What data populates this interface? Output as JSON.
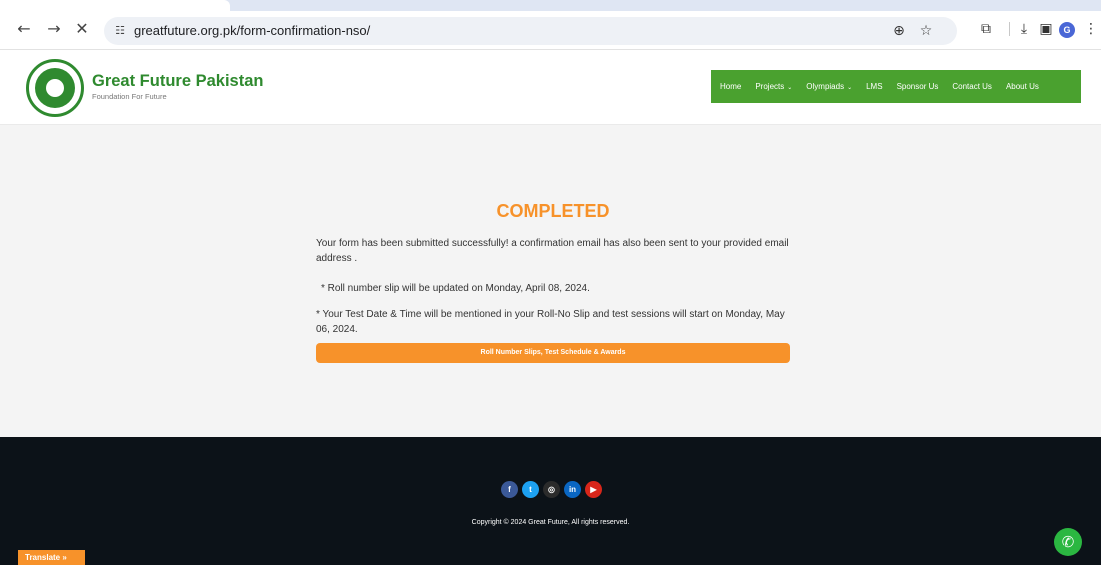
{
  "browser": {
    "url": "greatfuture.org.pk/form-confirmation-nso/",
    "back_icon": "←",
    "forward_icon": "→",
    "stop_icon": "✕",
    "site_info_icon": "☷",
    "zoom_icon": "⊕",
    "bookmark_icon": "☆",
    "extensions_icon": "⧉",
    "download_icon": "⤓",
    "sidepanel_icon": "▣",
    "profile_initial": "G",
    "menu_icon": "⋮"
  },
  "site": {
    "brand": "Great Future Pakistan",
    "tagline": "Foundation For Future",
    "menu": [
      {
        "label": "Home",
        "has_dropdown": false
      },
      {
        "label": "Projects",
        "has_dropdown": true
      },
      {
        "label": "Olympiads",
        "has_dropdown": true
      },
      {
        "label": "LMS",
        "has_dropdown": false
      },
      {
        "label": "Sponsor Us",
        "has_dropdown": false
      },
      {
        "label": "Contact Us",
        "has_dropdown": false
      },
      {
        "label": "About Us",
        "has_dropdown": false
      }
    ],
    "chevron": "⌄"
  },
  "main": {
    "heading": "COMPLETED",
    "message": "Your form has been submitted successfully! a confirmation email has also been sent to your provided email address .",
    "note_roll": "* Roll number slip will be updated on Monday, April 08, 2024.",
    "note_test": "* Your Test Date & Time will be mentioned in your Roll-No Slip and test sessions will start on Monday, May 06, 2024.",
    "cta_label": "Roll Number Slips, Test Schedule & Awards"
  },
  "footer": {
    "socials": [
      {
        "name": "facebook-icon",
        "glyph": "f",
        "color": "#3b5998"
      },
      {
        "name": "twitter-icon",
        "glyph": "t",
        "color": "#1da1f2"
      },
      {
        "name": "instagram-icon",
        "glyph": "◎",
        "color": "#2b2b2b"
      },
      {
        "name": "linkedin-icon",
        "glyph": "in",
        "color": "#0a66c2"
      },
      {
        "name": "youtube-icon",
        "glyph": "▶",
        "color": "#d8261a"
      }
    ],
    "copyright": "Copyright © 2024 Great Future, All rights reserved.",
    "translate_label": "Translate »",
    "whatsapp_glyph": "✆"
  },
  "colors": {
    "brand_green": "#2f8a2f",
    "menu_green": "#4aa12f",
    "accent_orange": "#f7922a",
    "footer_bg": "#0c1218"
  }
}
